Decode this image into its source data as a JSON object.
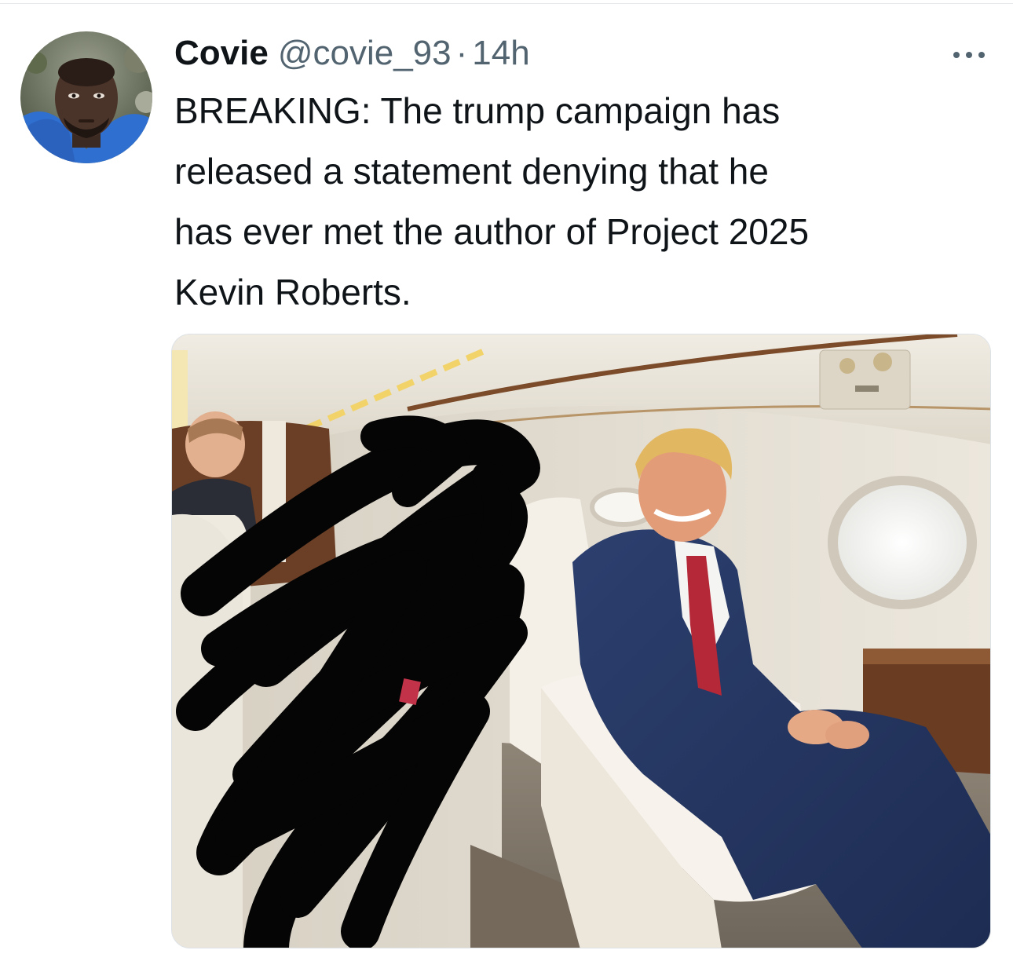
{
  "tweet": {
    "display_name": "Covie",
    "handle": "@covie_93",
    "separator": "·",
    "time": "14h",
    "text": "BREAKING: The trump campaign has\nreleased a statement denying that he\nhas ever met the author of Project 2025\nKevin Roberts.",
    "more_icon": "more-horizontal-icon",
    "avatar_icon": "user-avatar-photo",
    "media_icon": "attached-photo-plane-interior"
  },
  "colors": {
    "text_primary": "#0f1419",
    "text_secondary": "#536471",
    "divider": "#e6e9eb"
  }
}
